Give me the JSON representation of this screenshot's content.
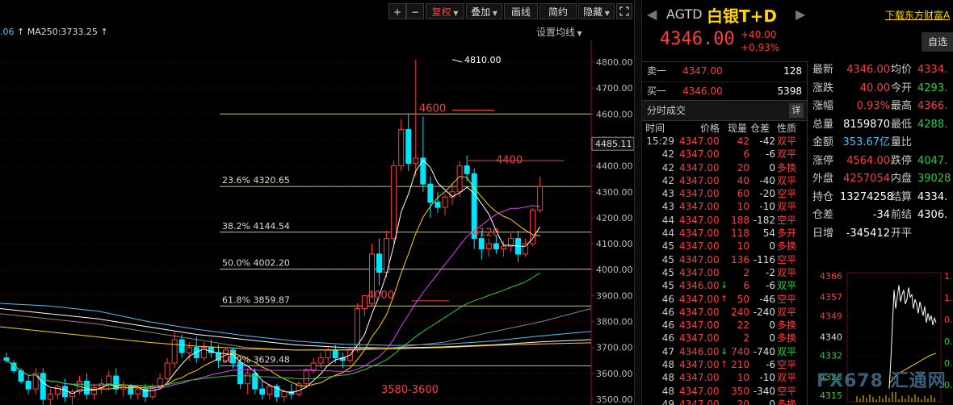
{
  "toolbar": {
    "plus": "+",
    "minus": "−",
    "fuquan": "复权",
    "diejia": "叠加",
    "huaxian": "画线",
    "jianyue": "简约",
    "yincang": "隐藏",
    "expand_icon": "expand-icon",
    "close_icon": "close-icon"
  },
  "ma_line": {
    "prefix": ".06",
    "ma250": "MA250:3733.25",
    "settings": "设置均线"
  },
  "chart_data": {
    "type": "candlestick",
    "y_ticks": [
      "4800.00",
      "4700.00",
      "4600.00",
      "4500.00",
      "4400.00",
      "4300.00",
      "4200.00",
      "4100.00",
      "4000.00",
      "3900.00",
      "3800.00",
      "3700.00",
      "3600.00",
      "3500.00"
    ],
    "ylim": [
      3500,
      4840
    ],
    "current_price_label": "4485.11",
    "fib_levels": [
      {
        "label": "23.6% 4320.65",
        "value": 4320.65
      },
      {
        "label": "38.2% 4144.54",
        "value": 4144.54
      },
      {
        "label": "50.0% 4002.20",
        "value": 4002.2
      },
      {
        "label": "61.8% 3859.87",
        "value": 3859.87
      },
      {
        "label": "80.9% 3629.48",
        "value": 3629.48
      }
    ],
    "extra_levels": [
      4600,
      4420
    ],
    "annotations": [
      {
        "text": "4810.00",
        "value": 4810
      },
      {
        "text": "4600",
        "value": 4600
      },
      {
        "text": "4400",
        "value": 4400
      },
      {
        "text": "4120",
        "value": 4120
      },
      {
        "text": "4000",
        "value": 3880
      },
      {
        "text": "3580-3600",
        "value": 3515
      }
    ],
    "candles": [
      [
        3660,
        3680,
        3650,
        3640
      ],
      [
        3640,
        3650,
        3610,
        3600
      ],
      [
        3610,
        3620,
        3570,
        3560
      ],
      [
        3570,
        3590,
        3540,
        3520
      ],
      [
        3540,
        3620,
        3600,
        3520
      ],
      [
        3600,
        3620,
        3500,
        3480
      ],
      [
        3500,
        3540,
        3520,
        3460
      ],
      [
        3520,
        3560,
        3550,
        3500
      ],
      [
        3550,
        3580,
        3510,
        3490
      ],
      [
        3510,
        3540,
        3530,
        3480
      ],
      [
        3530,
        3590,
        3570,
        3520
      ],
      [
        3570,
        3600,
        3520,
        3500
      ],
      [
        3520,
        3560,
        3545,
        3500
      ],
      [
        3545,
        3580,
        3560,
        3520
      ],
      [
        3560,
        3610,
        3590,
        3540
      ],
      [
        3590,
        3620,
        3540,
        3520
      ],
      [
        3540,
        3570,
        3550,
        3510
      ],
      [
        3550,
        3560,
        3520,
        3500
      ],
      [
        3520,
        3550,
        3540,
        3500
      ],
      [
        3540,
        3560,
        3510,
        3490
      ],
      [
        3510,
        3560,
        3550,
        3500
      ],
      [
        3550,
        3600,
        3580,
        3540
      ],
      [
        3580,
        3660,
        3640,
        3570
      ],
      [
        3640,
        3760,
        3730,
        3620
      ],
      [
        3730,
        3750,
        3680,
        3660
      ],
      [
        3680,
        3720,
        3700,
        3650
      ],
      [
        3700,
        3740,
        3660,
        3640
      ],
      [
        3660,
        3720,
        3700,
        3650
      ],
      [
        3700,
        3730,
        3680,
        3660
      ],
      [
        3680,
        3710,
        3650,
        3620
      ],
      [
        3650,
        3700,
        3690,
        3640
      ],
      [
        3690,
        3700,
        3640,
        3620
      ],
      [
        3640,
        3660,
        3560,
        3540
      ],
      [
        3560,
        3620,
        3600,
        3520
      ],
      [
        3600,
        3620,
        3540,
        3520
      ],
      [
        3540,
        3570,
        3520,
        3500
      ],
      [
        3520,
        3560,
        3550,
        3500
      ],
      [
        3550,
        3560,
        3510,
        3490
      ],
      [
        3510,
        3540,
        3530,
        3490
      ],
      [
        3530,
        3560,
        3520,
        3500
      ],
      [
        3520,
        3570,
        3560,
        3510
      ],
      [
        3560,
        3620,
        3610,
        3550
      ],
      [
        3610,
        3660,
        3640,
        3600
      ],
      [
        3640,
        3680,
        3660,
        3620
      ],
      [
        3660,
        3700,
        3690,
        3640
      ],
      [
        3690,
        3710,
        3660,
        3640
      ],
      [
        3660,
        3680,
        3650,
        3620
      ],
      [
        3650,
        3700,
        3690,
        3640
      ],
      [
        3690,
        3870,
        3850,
        3680
      ],
      [
        3850,
        3890,
        3900,
        3820
      ],
      [
        3870,
        4100,
        4060,
        3860
      ],
      [
        4060,
        4120,
        3990,
        3940
      ],
      [
        3990,
        4150,
        4120,
        3970
      ],
      [
        4120,
        4420,
        4400,
        4100
      ],
      [
        4400,
        4580,
        4540,
        4380
      ],
      [
        4540,
        4600,
        4410,
        4380
      ],
      [
        4410,
        4810,
        4430,
        4360
      ],
      [
        4430,
        4590,
        4330,
        4300
      ],
      [
        4330,
        4360,
        4260,
        4200
      ],
      [
        4260,
        4300,
        4240,
        4220
      ],
      [
        4240,
        4290,
        4280,
        4210
      ],
      [
        4280,
        4330,
        4300,
        4250
      ],
      [
        4300,
        4420,
        4400,
        4280
      ],
      [
        4400,
        4440,
        4370,
        4340
      ],
      [
        4370,
        4390,
        4120,
        4080
      ],
      [
        4120,
        4150,
        4080,
        4040
      ],
      [
        4080,
        4120,
        4100,
        4050
      ],
      [
        4100,
        4130,
        4080,
        4060
      ],
      [
        4080,
        4110,
        4090,
        4050
      ],
      [
        4090,
        4140,
        4120,
        4070
      ],
      [
        4120,
        4150,
        4060,
        4030
      ],
      [
        4060,
        4120,
        4100,
        4050
      ],
      [
        4100,
        4240,
        4230,
        4090
      ],
      [
        4230,
        4360,
        4320,
        4220
      ]
    ]
  },
  "header": {
    "code": "AGTD",
    "name": "白银T+D",
    "download_label": "下载东方财富A",
    "price": "4346.00",
    "change": "+40.00",
    "change_pct": "+0.93%",
    "zixuan_label": "自选"
  },
  "book": {
    "sell_label": "卖一",
    "sell_price": "4347.00",
    "sell_vol": "128",
    "buy_label": "买一",
    "buy_price": "4346.00",
    "buy_vol": "5398"
  },
  "trades": {
    "title": "分时成交",
    "detail_label": "详",
    "col_time": "时间",
    "col_price": "价格",
    "col_vol": "现量",
    "col_oi": "仓差",
    "col_nature": "性质",
    "rows": [
      {
        "time": "15:29",
        "price": "4347.00",
        "arrow": "",
        "vol": "42",
        "oi": "-42",
        "nature": "双平",
        "ncolor": "#ff3c3c"
      },
      {
        "time": "42",
        "price": "4347.00",
        "arrow": "",
        "vol": "6",
        "oi": "-6",
        "nature": "双平",
        "ncolor": "#ff3c3c"
      },
      {
        "time": "42",
        "price": "4347.00",
        "arrow": "",
        "vol": "20",
        "oi": "0",
        "nature": "多换",
        "ncolor": "#ff3c3c"
      },
      {
        "time": "42",
        "price": "4347.00",
        "arrow": "",
        "vol": "40",
        "oi": "-40",
        "nature": "双平",
        "ncolor": "#ff3c3c"
      },
      {
        "time": "43",
        "price": "4347.00",
        "arrow": "",
        "vol": "60",
        "oi": "-20",
        "nature": "空平",
        "ncolor": "#ff3c3c"
      },
      {
        "time": "43",
        "price": "4347.00",
        "arrow": "",
        "vol": "10",
        "oi": "-10",
        "nature": "双平",
        "ncolor": "#ff3c3c"
      },
      {
        "time": "44",
        "price": "4347.00",
        "arrow": "",
        "vol": "188",
        "oi": "-182",
        "nature": "空平",
        "ncolor": "#ff3c3c"
      },
      {
        "time": "44",
        "price": "4347.00",
        "arrow": "",
        "vol": "118",
        "oi": "54",
        "nature": "多开",
        "ncolor": "#ff3c3c"
      },
      {
        "time": "45",
        "price": "4347.00",
        "arrow": "",
        "vol": "10",
        "oi": "0",
        "nature": "多换",
        "ncolor": "#ff3c3c"
      },
      {
        "time": "45",
        "price": "4347.00",
        "arrow": "",
        "vol": "136",
        "oi": "-116",
        "nature": "空平",
        "ncolor": "#ff3c3c"
      },
      {
        "time": "45",
        "price": "4347.00",
        "arrow": "",
        "vol": "2",
        "oi": "-2",
        "nature": "双平",
        "ncolor": "#ff3c3c"
      },
      {
        "time": "45",
        "price": "4346.00",
        "arrow": "↓",
        "vol": "6",
        "oi": "-6",
        "nature": "双平",
        "ncolor": "#2ecc40"
      },
      {
        "time": "46",
        "price": "4347.00",
        "arrow": "↑",
        "vol": "50",
        "oi": "-46",
        "nature": "空平",
        "ncolor": "#ff3c3c"
      },
      {
        "time": "46",
        "price": "4347.00",
        "arrow": "",
        "vol": "240",
        "oi": "-240",
        "nature": "双平",
        "ncolor": "#ff3c3c"
      },
      {
        "time": "46",
        "price": "4347.00",
        "arrow": "",
        "vol": "22",
        "oi": "0",
        "nature": "多换",
        "ncolor": "#ff3c3c"
      },
      {
        "time": "46",
        "price": "4347.00",
        "arrow": "",
        "vol": "2",
        "oi": "0",
        "nature": "多换",
        "ncolor": "#ff3c3c"
      },
      {
        "time": "47",
        "price": "4346.00",
        "arrow": "↓",
        "vol": "740",
        "oi": "-740",
        "nature": "双平",
        "ncolor": "#2ecc40"
      },
      {
        "time": "48",
        "price": "4347.00",
        "arrow": "↑",
        "vol": "210",
        "oi": "-6",
        "nature": "空平",
        "ncolor": "#ff3c3c"
      },
      {
        "time": "48",
        "price": "4347.00",
        "arrow": "",
        "vol": "10",
        "oi": "-10",
        "nature": "双平",
        "ncolor": "#ff3c3c"
      },
      {
        "time": "48",
        "price": "4347.00",
        "arrow": "",
        "vol": "350",
        "oi": "-340",
        "nature": "空平",
        "ncolor": "#ff3c3c"
      },
      {
        "time": "49",
        "price": "4347.00",
        "arrow": "",
        "vol": "20",
        "oi": "0",
        "nature": "多换",
        "ncolor": "#ff3c3c"
      }
    ]
  },
  "stats": [
    {
      "k1": "最新",
      "v1": "4346.00",
      "c1": "#ff3c3c",
      "k2": "均价",
      "v2": "4334.",
      "c2": "#ff3c3c"
    },
    {
      "k1": "涨跌",
      "v1": "40.00",
      "c1": "#ff3c3c",
      "k2": "今开",
      "v2": "4293.",
      "c2": "#2ecc40"
    },
    {
      "k1": "涨幅",
      "v1": "0.93%",
      "c1": "#ff3c3c",
      "k2": "最高",
      "v2": "4366.",
      "c2": "#ff3c3c"
    },
    {
      "k1": "总量",
      "v1": "8159870",
      "c1": "#ffffff",
      "k2": "最低",
      "v2": "4288.",
      "c2": "#2ecc40"
    },
    {
      "k1": "金额",
      "v1": "353.67亿",
      "c1": "#4fc3f7",
      "k2": "量比",
      "v2": "",
      "c2": "#ffffff"
    },
    {
      "k1": "涨停",
      "v1": "4564.00",
      "c1": "#ff3c3c",
      "k2": "跌停",
      "v2": "4047.",
      "c2": "#2ecc40"
    },
    {
      "k1": "外盘",
      "v1": "4257054",
      "c1": "#ff3c3c",
      "k2": "内盘",
      "v2": "39028",
      "c2": "#2ecc40"
    },
    {
      "k1": "持仓",
      "v1": "13274258",
      "c1": "#ffffff",
      "k2": "结算",
      "v2": "4334.",
      "c2": "#ffffff"
    },
    {
      "k1": "仓差",
      "v1": "-34",
      "c1": "#ffffff",
      "k2": "前结",
      "v2": "4306.",
      "c2": "#ffffff"
    },
    {
      "k1": "日增",
      "v1": "-345412",
      "c1": "#ffffff",
      "k2": "开平",
      "v2": "",
      "c2": "#ffffff"
    }
  ],
  "mini_chart": {
    "type": "line",
    "y_labels": [
      "4366",
      "4357",
      "4349",
      "4340",
      "4332",
      "4323",
      "4315"
    ],
    "ylim": [
      4315,
      4366
    ],
    "right_labels": [
      "1.",
      "1.",
      "0.",
      "0.",
      "0.",
      "0."
    ]
  },
  "watermark": "FX678 汇通网",
  "colors": {
    "up": "#ff3c3c",
    "down": "#00e5ff",
    "fib": "#c8c850",
    "red_line": "#ff3c3c"
  }
}
